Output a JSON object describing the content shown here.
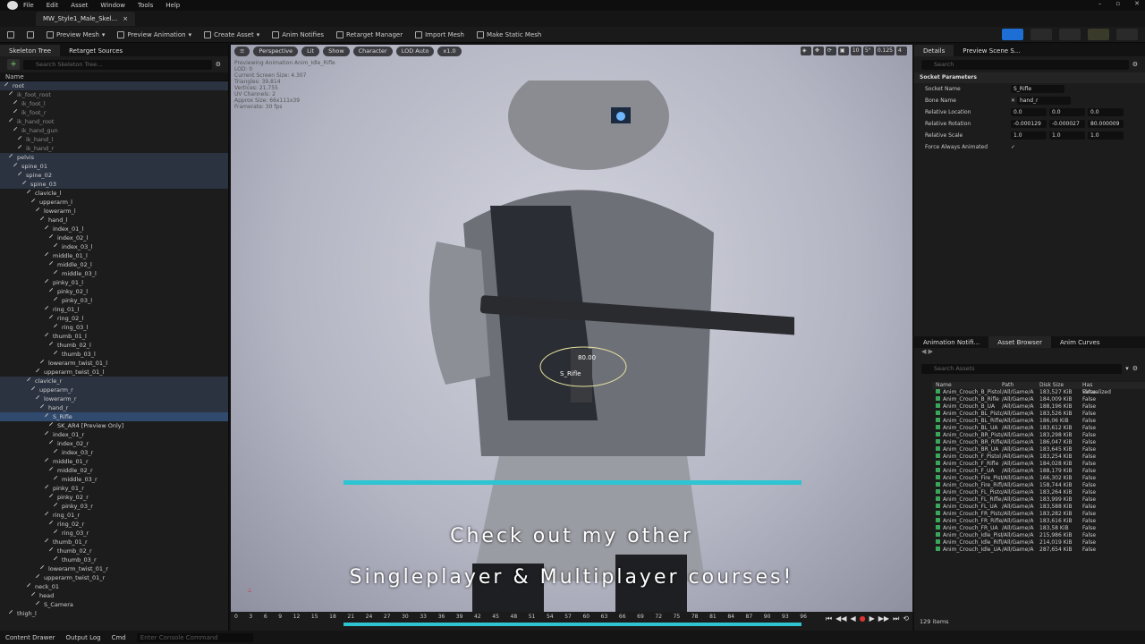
{
  "menu": [
    "File",
    "Edit",
    "Asset",
    "Window",
    "Tools",
    "Help"
  ],
  "doc_tab": "MW_Style1_Male_Skel...",
  "toolbar": [
    "Preview Mesh",
    "Preview Animation",
    "Create Asset",
    "Anim Notifies",
    "Retarget Manager",
    "Import Mesh",
    "Make Static Mesh"
  ],
  "left_tabs": [
    "Skeleton Tree",
    "Retarget Sources"
  ],
  "skeleton_search": "Search Skeleton Tree...",
  "name_col": "Name",
  "tree": [
    {
      "d": 0,
      "t": "root",
      "c": "hl"
    },
    {
      "d": 1,
      "t": "ik_foot_root",
      "c": "dim"
    },
    {
      "d": 2,
      "t": "ik_foot_l",
      "c": "dim"
    },
    {
      "d": 2,
      "t": "ik_foot_r",
      "c": "dim"
    },
    {
      "d": 1,
      "t": "ik_hand_root",
      "c": "dim"
    },
    {
      "d": 2,
      "t": "ik_hand_gun",
      "c": "dim"
    },
    {
      "d": 3,
      "t": "ik_hand_l",
      "c": "dim"
    },
    {
      "d": 3,
      "t": "ik_hand_r",
      "c": "dim"
    },
    {
      "d": 1,
      "t": "pelvis",
      "c": "hl"
    },
    {
      "d": 2,
      "t": "spine_01",
      "c": "hl"
    },
    {
      "d": 3,
      "t": "spine_02",
      "c": "hl"
    },
    {
      "d": 4,
      "t": "spine_03",
      "c": "hl"
    },
    {
      "d": 5,
      "t": "clavicle_l"
    },
    {
      "d": 6,
      "t": "upperarm_l"
    },
    {
      "d": 7,
      "t": "lowerarm_l"
    },
    {
      "d": 8,
      "t": "hand_l"
    },
    {
      "d": 9,
      "t": "index_01_l"
    },
    {
      "d": 10,
      "t": "index_02_l"
    },
    {
      "d": 11,
      "t": "index_03_l"
    },
    {
      "d": 9,
      "t": "middle_01_l"
    },
    {
      "d": 10,
      "t": "middle_02_l"
    },
    {
      "d": 11,
      "t": "middle_03_l"
    },
    {
      "d": 9,
      "t": "pinky_01_l"
    },
    {
      "d": 10,
      "t": "pinky_02_l"
    },
    {
      "d": 11,
      "t": "pinky_03_l"
    },
    {
      "d": 9,
      "t": "ring_01_l"
    },
    {
      "d": 10,
      "t": "ring_02_l"
    },
    {
      "d": 11,
      "t": "ring_03_l"
    },
    {
      "d": 9,
      "t": "thumb_01_l"
    },
    {
      "d": 10,
      "t": "thumb_02_l"
    },
    {
      "d": 11,
      "t": "thumb_03_l"
    },
    {
      "d": 8,
      "t": "lowerarm_twist_01_l"
    },
    {
      "d": 7,
      "t": "upperarm_twist_01_l"
    },
    {
      "d": 5,
      "t": "clavicle_r",
      "c": "hl"
    },
    {
      "d": 6,
      "t": "upperarm_r",
      "c": "hl"
    },
    {
      "d": 7,
      "t": "lowerarm_r",
      "c": "hl"
    },
    {
      "d": 8,
      "t": "hand_r",
      "c": "hl"
    },
    {
      "d": 9,
      "t": "S_Rifle",
      "c": "sel"
    },
    {
      "d": 10,
      "t": "SK_AR4 [Preview Only]"
    },
    {
      "d": 9,
      "t": "index_01_r"
    },
    {
      "d": 10,
      "t": "index_02_r"
    },
    {
      "d": 11,
      "t": "index_03_r"
    },
    {
      "d": 9,
      "t": "middle_01_r"
    },
    {
      "d": 10,
      "t": "middle_02_r"
    },
    {
      "d": 11,
      "t": "middle_03_r"
    },
    {
      "d": 9,
      "t": "pinky_01_r"
    },
    {
      "d": 10,
      "t": "pinky_02_r"
    },
    {
      "d": 11,
      "t": "pinky_03_r"
    },
    {
      "d": 9,
      "t": "ring_01_r"
    },
    {
      "d": 10,
      "t": "ring_02_r"
    },
    {
      "d": 11,
      "t": "ring_03_r"
    },
    {
      "d": 9,
      "t": "thumb_01_r"
    },
    {
      "d": 10,
      "t": "thumb_02_r"
    },
    {
      "d": 11,
      "t": "thumb_03_r"
    },
    {
      "d": 8,
      "t": "lowerarm_twist_01_r"
    },
    {
      "d": 7,
      "t": "upperarm_twist_01_r"
    },
    {
      "d": 5,
      "t": "neck_01"
    },
    {
      "d": 6,
      "t": "head"
    },
    {
      "d": 7,
      "t": "S_Camera"
    },
    {
      "d": 1,
      "t": "thigh_l"
    }
  ],
  "viewport": {
    "buttons": [
      "Perspective",
      "Lit",
      "Show",
      "Character",
      "LOD Auto",
      "x1.0"
    ],
    "right": [
      "10",
      "5°",
      "0.125",
      "4"
    ],
    "stats": [
      "Previewing Animation Anim_Idle_Rifle",
      "LOD: 0",
      "Current Screen Size: 4.307",
      "Triangles: 39,814",
      "Vertices: 21,755",
      "UV Channels: 2",
      "Approx Size: 66x111x39",
      "Framerate: 30 fps"
    ],
    "socket_label": "S_Rifle",
    "angle_label": "80.00"
  },
  "subtitle": {
    "line1": "Check out my other",
    "line2": "Singleplayer & Multiplayer courses!"
  },
  "timeline": {
    "ticks": [
      "0",
      "3",
      "6",
      "9",
      "12",
      "15",
      "18",
      "21",
      "24",
      "27",
      "30",
      "33",
      "36",
      "39",
      "42",
      "45",
      "48",
      "51",
      "54",
      "57",
      "60",
      "63",
      "66",
      "69",
      "72",
      "75",
      "78",
      "81",
      "84",
      "87",
      "90",
      "93",
      "96"
    ]
  },
  "details": {
    "tabs": [
      "Details",
      "Preview Scene S..."
    ],
    "search": "Search",
    "section": "Socket Parameters",
    "socket_name_label": "Socket Name",
    "socket_name": "S_Rifle",
    "bone_name_label": "Bone Name",
    "bone_name": "hand_r",
    "loc_label": "Relative Location",
    "loc": [
      "0.0",
      "0.0",
      "0.0"
    ],
    "rot_label": "Relative Rotation",
    "rot": [
      "-0.000129",
      "-0.000027",
      "80.000009"
    ],
    "scale_label": "Relative Scale",
    "scale": [
      "1.0",
      "1.0",
      "1.0"
    ],
    "force_label": "Force Always Animated"
  },
  "asset_browser": {
    "tabs": [
      "Animation Notifi...",
      "Asset Browser",
      "Anim Curves"
    ],
    "search": "Search Assets",
    "headers": [
      "Name",
      "Path",
      "Disk Size",
      "Has Virtualized"
    ],
    "rows": [
      [
        "Anim_Crouch_B_Pistol",
        "/All/Game/A",
        "183,527 KiB",
        "False"
      ],
      [
        "Anim_Crouch_B_Rifle",
        "/All/Game/A",
        "184,009 KiB",
        "False"
      ],
      [
        "Anim_Crouch_B_UA",
        "/All/Game/A",
        "188,196 KiB",
        "False"
      ],
      [
        "Anim_Crouch_BL_Pistol",
        "/All/Game/A",
        "183,526 KiB",
        "False"
      ],
      [
        "Anim_Crouch_BL_Rifle",
        "/All/Game/A",
        "186,06 KiB",
        "False"
      ],
      [
        "Anim_Crouch_BL_UA",
        "/All/Game/A",
        "183,612 KiB",
        "False"
      ],
      [
        "Anim_Crouch_BR_Pistol",
        "/All/Game/A",
        "183,298 KiB",
        "False"
      ],
      [
        "Anim_Crouch_BR_Rifle",
        "/All/Game/A",
        "186,047 KiB",
        "False"
      ],
      [
        "Anim_Crouch_BR_UA",
        "/All/Game/A",
        "183,645 KiB",
        "False"
      ],
      [
        "Anim_Crouch_F_Pistol",
        "/All/Game/A",
        "183,254 KiB",
        "False"
      ],
      [
        "Anim_Crouch_F_Rifle",
        "/All/Game/A",
        "184,028 KiB",
        "False"
      ],
      [
        "Anim_Crouch_F_UA",
        "/All/Game/A",
        "188,179 KiB",
        "False"
      ],
      [
        "Anim_Crouch_Fire_Pistol",
        "/All/Game/A",
        "166,302 KiB",
        "False"
      ],
      [
        "Anim_Crouch_Fire_Rifle",
        "/All/Game/A",
        "158,744 KiB",
        "False"
      ],
      [
        "Anim_Crouch_FL_Pistol",
        "/All/Game/A",
        "183,264 KiB",
        "False"
      ],
      [
        "Anim_Crouch_FL_Rifle",
        "/All/Game/A",
        "183,999 KiB",
        "False"
      ],
      [
        "Anim_Crouch_FL_UA",
        "/All/Game/A",
        "183,588 KiB",
        "False"
      ],
      [
        "Anim_Crouch_FR_Pistol",
        "/All/Game/A",
        "183,282 KiB",
        "False"
      ],
      [
        "Anim_Crouch_FR_Rifle",
        "/All/Game/A",
        "183,616 KiB",
        "False"
      ],
      [
        "Anim_Crouch_FR_UA",
        "/All/Game/A",
        "183,58 KiB",
        "False"
      ],
      [
        "Anim_Crouch_Idle_Pistol",
        "/All/Game/A",
        "215,986 KiB",
        "False"
      ],
      [
        "Anim_Crouch_Idle_Rifle",
        "/All/Game/A",
        "214,019 KiB",
        "False"
      ],
      [
        "Anim_Crouch_Idle_UA",
        "/All/Game/A",
        "287,654 KiB",
        "False"
      ]
    ],
    "count": "129 items"
  },
  "status": {
    "drawer": "Content Drawer",
    "output": "Output Log",
    "cmd": "Cmd",
    "console": "Enter Console Command"
  }
}
